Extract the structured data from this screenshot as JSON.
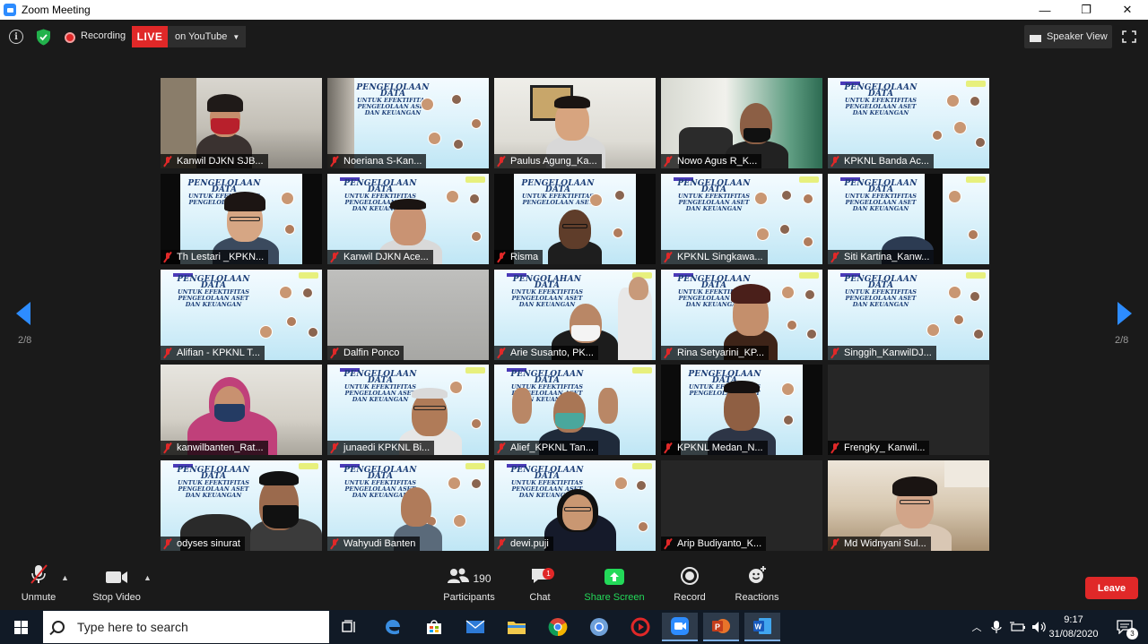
{
  "window": {
    "title": "Zoom Meeting",
    "min_glyph": "—",
    "restore_glyph": "❐",
    "close_glyph": "✕"
  },
  "topbar": {
    "recording_label": "Recording",
    "live_label": "LIVE",
    "stream_label": "on YouTube",
    "view_label": "Speaker View"
  },
  "pagination": {
    "left": "2/8",
    "right": "2/8"
  },
  "participants": [
    {
      "name": "Kanwil DJKN SJB..."
    },
    {
      "name": "Noeriana S-Kan..."
    },
    {
      "name": "Paulus Agung_Ka..."
    },
    {
      "name": "Nowo Agus R_K..."
    },
    {
      "name": "KPKNL Banda Ac..."
    },
    {
      "name": "Th Lestari _KPKN..."
    },
    {
      "name": "Kanwil DJKN Ace..."
    },
    {
      "name": "Risma"
    },
    {
      "name": "KPKNL Singkawa..."
    },
    {
      "name": "Siti Kartina_Kanw..."
    },
    {
      "name": "Alifian - KPKNL T..."
    },
    {
      "name": "Dalfin Ponco"
    },
    {
      "name": "Arie Susanto, PK..."
    },
    {
      "name": "Rina Setyarini_KP..."
    },
    {
      "name": "Singgih_KanwilDJ..."
    },
    {
      "name": "kanwilbanten_Rat..."
    },
    {
      "name": "junaedi KPKNL Bi..."
    },
    {
      "name": "Alief_KPKNL Tan..."
    },
    {
      "name": "KPKNL Medan_N..."
    },
    {
      "name": "Frengky_ Kanwil..."
    },
    {
      "name": "odyses sinurat"
    },
    {
      "name": "Wahyudi Banten"
    },
    {
      "name": "dewi.puji"
    },
    {
      "name": "Arip Budiyanto_K..."
    },
    {
      "name": "Md Widnyani Sul..."
    }
  ],
  "slide": {
    "tag": "",
    "line1": "PENGELOLAAN DATA",
    "line2": "UNTUK EFEKTIFITAS",
    "line3": "PENGELOLAAN ASET",
    "line4": "DAN KEUANGAN",
    "alt_line1": "PENGOLAHAN DATA"
  },
  "toolbar": {
    "unmute": "Unmute",
    "stop_video": "Stop Video",
    "participants": "Participants",
    "participants_count": "190",
    "chat": "Chat",
    "chat_badge": "1",
    "share_screen": "Share Screen",
    "record": "Record",
    "reactions": "Reactions",
    "leave": "Leave"
  },
  "taskbar": {
    "search_placeholder": "Type here to search",
    "time": "9:17",
    "date": "31/08/2020",
    "notification_count": "3"
  },
  "colors": {
    "accent": "#2d8cff",
    "live": "#e02828",
    "share": "#23d959",
    "background": "#1a1a1a"
  }
}
